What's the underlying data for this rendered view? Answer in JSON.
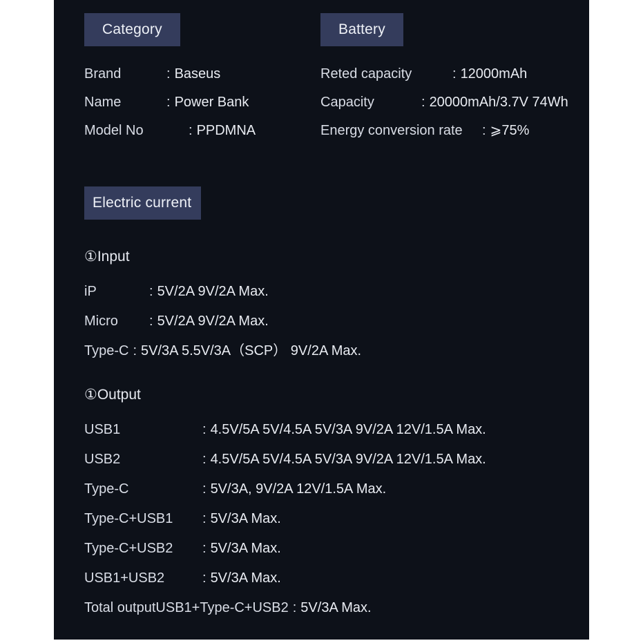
{
  "panel": {
    "background": "#0d1119",
    "chip_background": "#343c5c",
    "text_color": "#d9dde6"
  },
  "sections": {
    "category": {
      "chip_label": "Category",
      "rows": [
        {
          "label": "Brand",
          "sep": ":",
          "value": "Baseus"
        },
        {
          "label": "Name",
          "sep": ":",
          "value": "Power Bank"
        },
        {
          "label": "Model No",
          "sep": ":",
          "value": "PPDMNA"
        }
      ]
    },
    "battery": {
      "chip_label": "Battery",
      "rows": [
        {
          "label": "Reted capacity",
          "sep": ":",
          "value": "12000mAh"
        },
        {
          "label": "Capacity",
          "sep": ":",
          "value": "20000mAh/3.7V 74Wh"
        },
        {
          "label": "Energy conversion rate",
          "sep": ":",
          "value": "⩾75%"
        }
      ]
    },
    "electric_current": {
      "chip_label": "Electric current",
      "input": {
        "heading": "①Input",
        "rows": [
          {
            "label": "iP",
            "sep": ":",
            "value": "5V/2A  9V/2A  Max."
          },
          {
            "label": "Micro",
            "sep": ":",
            "value": "5V/2A  9V/2A  Max."
          },
          {
            "label": "Type-C",
            "sep": ":",
            "value": "5V/3A 5.5V/3A（SCP） 9V/2A Max."
          }
        ]
      },
      "output": {
        "heading": "①Output",
        "rows": [
          {
            "label": "USB1",
            "sep": ":",
            "value": "4.5V/5A 5V/4.5A  5V/3A 9V/2A 12V/1.5A Max."
          },
          {
            "label": "USB2",
            "sep": ":",
            "value": "4.5V/5A 5V/4.5A  5V/3A 9V/2A 12V/1.5A Max."
          },
          {
            "label": "Type-C",
            "sep": ":",
            "value": "5V/3A, 9V/2A  12V/1.5A Max."
          },
          {
            "label": "Type-C+USB1",
            "sep": ":",
            "value": "5V/3A Max."
          },
          {
            "label": "Type-C+USB2",
            "sep": ":",
            "value": "5V/3A Max."
          },
          {
            "label": "USB1+USB2",
            "sep": ":",
            "value": "5V/3A Max."
          },
          {
            "label": "Total outputUSB1+Type-C+USB2",
            "sep": ":",
            "value": "5V/3A Max."
          }
        ]
      }
    }
  }
}
